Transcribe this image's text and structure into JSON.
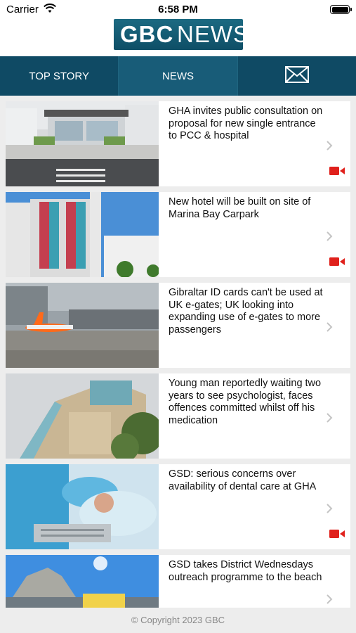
{
  "status_bar": {
    "carrier": "Carrier",
    "time": "6:58 PM"
  },
  "header": {
    "logo_left": "GBC",
    "logo_right": "NEWS"
  },
  "tabs": [
    {
      "label": "TOP STORY",
      "active": false
    },
    {
      "label": "NEWS",
      "active": true
    },
    {
      "label": "",
      "icon": "mail-icon",
      "active": false
    }
  ],
  "articles": [
    {
      "title": "GHA invites public consultation on proposal for new single entrance to PCC & hospital",
      "has_video": true,
      "image": "hospital-entrance-render"
    },
    {
      "title": "New hotel will be built on site of Marina Bay Carpark",
      "has_video": true,
      "image": "hotel-render"
    },
    {
      "title": "Gibraltar ID cards can't be used at UK e-gates; UK looking into expanding use of e-gates to more passengers",
      "has_video": false,
      "image": "airport-plane"
    },
    {
      "title": "Young man reportedly waiting two years to see psychologist, faces offences committed whilst off his medication",
      "has_video": false,
      "image": "building-exterior"
    },
    {
      "title": "GSD: serious concerns over availability of dental care at GHA",
      "has_video": true,
      "image": "dental-patient"
    },
    {
      "title": "GSD takes District Wednesdays outreach programme to the beach",
      "has_video": false,
      "image": "rock-of-gibraltar"
    }
  ],
  "footer": {
    "copyright": "© Copyright 2023 GBC"
  },
  "colors": {
    "nav_bg": "#0f4a64",
    "nav_active": "#185c78",
    "video_red": "#e0211c",
    "background": "#ededed"
  }
}
